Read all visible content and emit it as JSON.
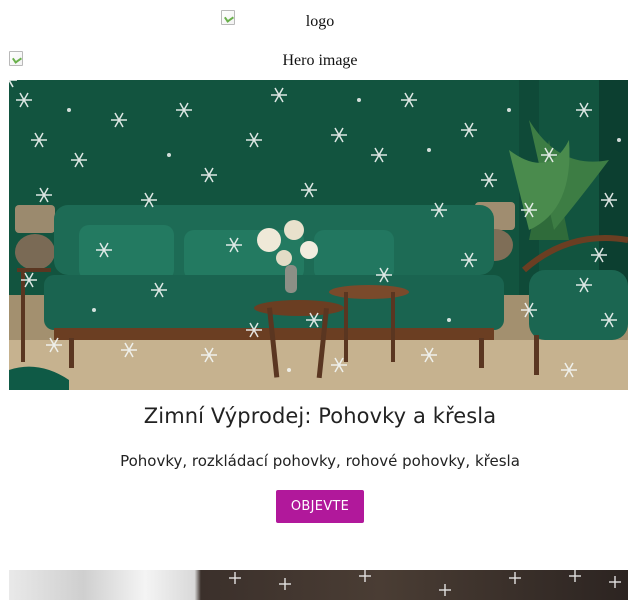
{
  "logo": {
    "alt": "logo"
  },
  "hero": {
    "alt": "Hero image"
  },
  "promo": {
    "headline": "Zimní Výprodej: Pohovky a křesla",
    "subline": "Pohovky, rozkládací pohovky, rohové pohovky, křesla",
    "cta_label": "OBJEVTE"
  },
  "colors": {
    "accent": "#b1189b",
    "wall_green": "#125b47",
    "sofa_green": "#1a6e57"
  }
}
